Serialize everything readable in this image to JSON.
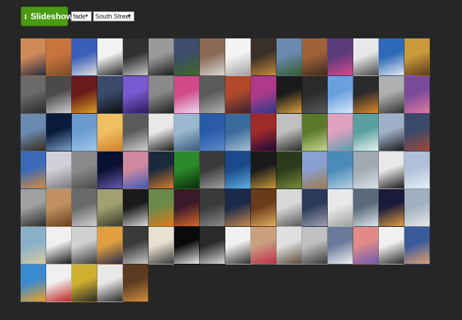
{
  "toolbar": {
    "slideshow_label": "Slideshow",
    "effect_value": "fade",
    "album_value": "South Street"
  },
  "thumbnails": [
    [
      "#d08a5a",
      "#2a2b3f"
    ],
    [
      "#c8743f",
      "#7b4a2a"
    ],
    [
      "#3a5fb8",
      "#e0e0e0"
    ],
    [
      "#f2f2f2",
      "#2a2a2a"
    ],
    [
      "#303030",
      "#c8c8c8"
    ],
    [
      "#9a9a9a",
      "#1c1c1c"
    ],
    [
      "#3c4c6a",
      "#3e6b22"
    ],
    [
      "#8a6a55",
      "#d8d8d8"
    ],
    [
      "#f4f4f4",
      "#a0a0a0"
    ],
    [
      "#3a3028",
      "#c88a3a"
    ],
    [
      "#6a8ab0",
      "#2f5a2a"
    ],
    [
      "#a06038",
      "#3a2a20"
    ],
    [
      "#5a3a7a",
      "#d84a8a"
    ],
    [
      "#e8e8ea",
      "#4a4a4a"
    ],
    [
      "#2a6ab8",
      "#e8e8f0"
    ],
    [
      "#c89a3a",
      "#5a3a1a"
    ],
    [
      "#6a6a6a",
      "#2a2a2a"
    ],
    [
      "#4a4a4a",
      "#cfcfcf"
    ],
    [
      "#6a1a1a",
      "#d8a020"
    ],
    [
      "#3a4a6a",
      "#0f0f0f"
    ],
    [
      "#7a5ad0",
      "#2a1a5a"
    ],
    [
      "#8a8a8a",
      "#202020"
    ],
    [
      "#d04a8a",
      "#eadcf0"
    ],
    [
      "#5a5a5a",
      "#b0b0b0"
    ],
    [
      "#b04a2a",
      "#3a2030"
    ],
    [
      "#b03a8a",
      "#2a3a8a"
    ],
    [
      "#1a1a1a",
      "#d8a040"
    ],
    [
      "#2a2a2a",
      "#5a5a5a"
    ],
    [
      "#6aa0e0",
      "#d8e8f8"
    ],
    [
      "#2a2a2a",
      "#e08a2a"
    ],
    [
      "#b0b0b0",
      "#303030"
    ],
    [
      "#7a4a9a",
      "#e07aa0"
    ],
    [
      "#6a8ab0",
      "#3a2a1a"
    ],
    [
      "#0a1a3a",
      "#7aa0c8"
    ],
    [
      "#6a9ad0",
      "#a0c8e8"
    ],
    [
      "#f0c060",
      "#d08030"
    ],
    [
      "#5a5a5a",
      "#d0d0d0"
    ],
    [
      "#e8e8e8",
      "#1a1a1a"
    ],
    [
      "#9ab8d0",
      "#3a5a7a"
    ],
    [
      "#2a5aa8",
      "#5a8ac8"
    ],
    [
      "#3a6a9a",
      "#a8c0d8"
    ],
    [
      "#a02a2a",
      "#1a0a3a"
    ],
    [
      "#c0c0c0",
      "#2a2a2a"
    ],
    [
      "#5a7a2a",
      "#c8d890"
    ],
    [
      "#e0a0c0",
      "#5aa0b0"
    ],
    [
      "#5aa0a0",
      "#e8f0f0"
    ],
    [
      "#a0b0c8",
      "#1a1a1a"
    ],
    [
      "#3a4a6a",
      "#a04a3a"
    ],
    [
      "#3a6ab8",
      "#d88a3a"
    ],
    [
      "#d0d0d8",
      "#7a7a7a"
    ],
    [
      "#8a8a8a",
      "#4a4a4a"
    ],
    [
      "#0a1030",
      "#6a5ab0"
    ],
    [
      "#d08aa0",
      "#3a5ab8"
    ],
    [
      "#1a2a3a",
      "#d87a30"
    ],
    [
      "#2a8a2a",
      "#0a2a0a"
    ],
    [
      "#3a3a3a",
      "#a0a0a0"
    ],
    [
      "#1a4a8a",
      "#60b0e0"
    ],
    [
      "#1a1a1a",
      "#c89a3a"
    ],
    [
      "#2a3a1a",
      "#7a8a3a"
    ],
    [
      "#8aa0d0",
      "#a07a4a"
    ],
    [
      "#4a8ab8",
      "#b8d0e0"
    ],
    [
      "#a0a8b0",
      "#d8e0e8"
    ],
    [
      "#e8e8e8",
      "#1a1a1a"
    ],
    [
      "#b0c0d8",
      "#e8f0f8"
    ],
    [
      "#a0a0a0",
      "#2a2a2a"
    ],
    [
      "#c09060",
      "#6a4020"
    ],
    [
      "#6a6a6a",
      "#d0d0d0"
    ],
    [
      "#a0a070",
      "#3a3a2a"
    ],
    [
      "#1a1a1a",
      "#d8d8d8"
    ],
    [
      "#6a8a4a",
      "#e07a1a"
    ],
    [
      "#3a1a2a",
      "#d86a2a"
    ],
    [
      "#3a3a3a",
      "#8a8a8a"
    ],
    [
      "#1a2a4a",
      "#c88a4a"
    ],
    [
      "#6a3a1a",
      "#e0b060"
    ],
    [
      "#d8d8d8",
      "#5a5a5a"
    ],
    [
      "#2a3a5a",
      "#a0a0b0"
    ],
    [
      "#e8e8e8",
      "#a0a0a0"
    ],
    [
      "#5a6a7a",
      "#e0e8f0"
    ],
    [
      "#1a1a3a",
      "#e0a040"
    ],
    [
      "#a0b0c0",
      "#e8e8e8"
    ],
    [
      "#8ab0c8",
      "#d8c8a0"
    ],
    [
      "#f0f0f0",
      "#1a1a1a"
    ],
    [
      "#d0d0d0",
      "#3a3a3a"
    ],
    [
      "#e0a040",
      "#2a2a4a"
    ],
    [
      "#3a3a3a",
      "#c8c8c8"
    ],
    [
      "#e8e0d0",
      "#3a3a3a"
    ],
    [
      "#0a0a0a",
      "#e8e8e8"
    ],
    [
      "#2a2a2a",
      "#d8d8d8"
    ],
    [
      "#f0f0f0",
      "#303030"
    ],
    [
      "#c8a080",
      "#c02a4a"
    ],
    [
      "#e0e0e0",
      "#5a4a3a"
    ],
    [
      "#c0c0c0",
      "#3a3a3a"
    ],
    [
      "#6a7a9a",
      "#f0f0f0"
    ],
    [
      "#e08a8a",
      "#6a5ab0"
    ],
    [
      "#f0f0f0",
      "#2a2a2a"
    ],
    [
      "#3a5a9a",
      "#e0a070"
    ],
    [
      "#3a8ad0",
      "#f0a020"
    ],
    [
      "#f0f0f0",
      "#c02020"
    ],
    [
      "#d0b030",
      "#2a2a2a"
    ],
    [
      "#e8e8e8",
      "#2a2a2a"
    ],
    [
      "#5a3a20",
      "#d09040"
    ]
  ]
}
